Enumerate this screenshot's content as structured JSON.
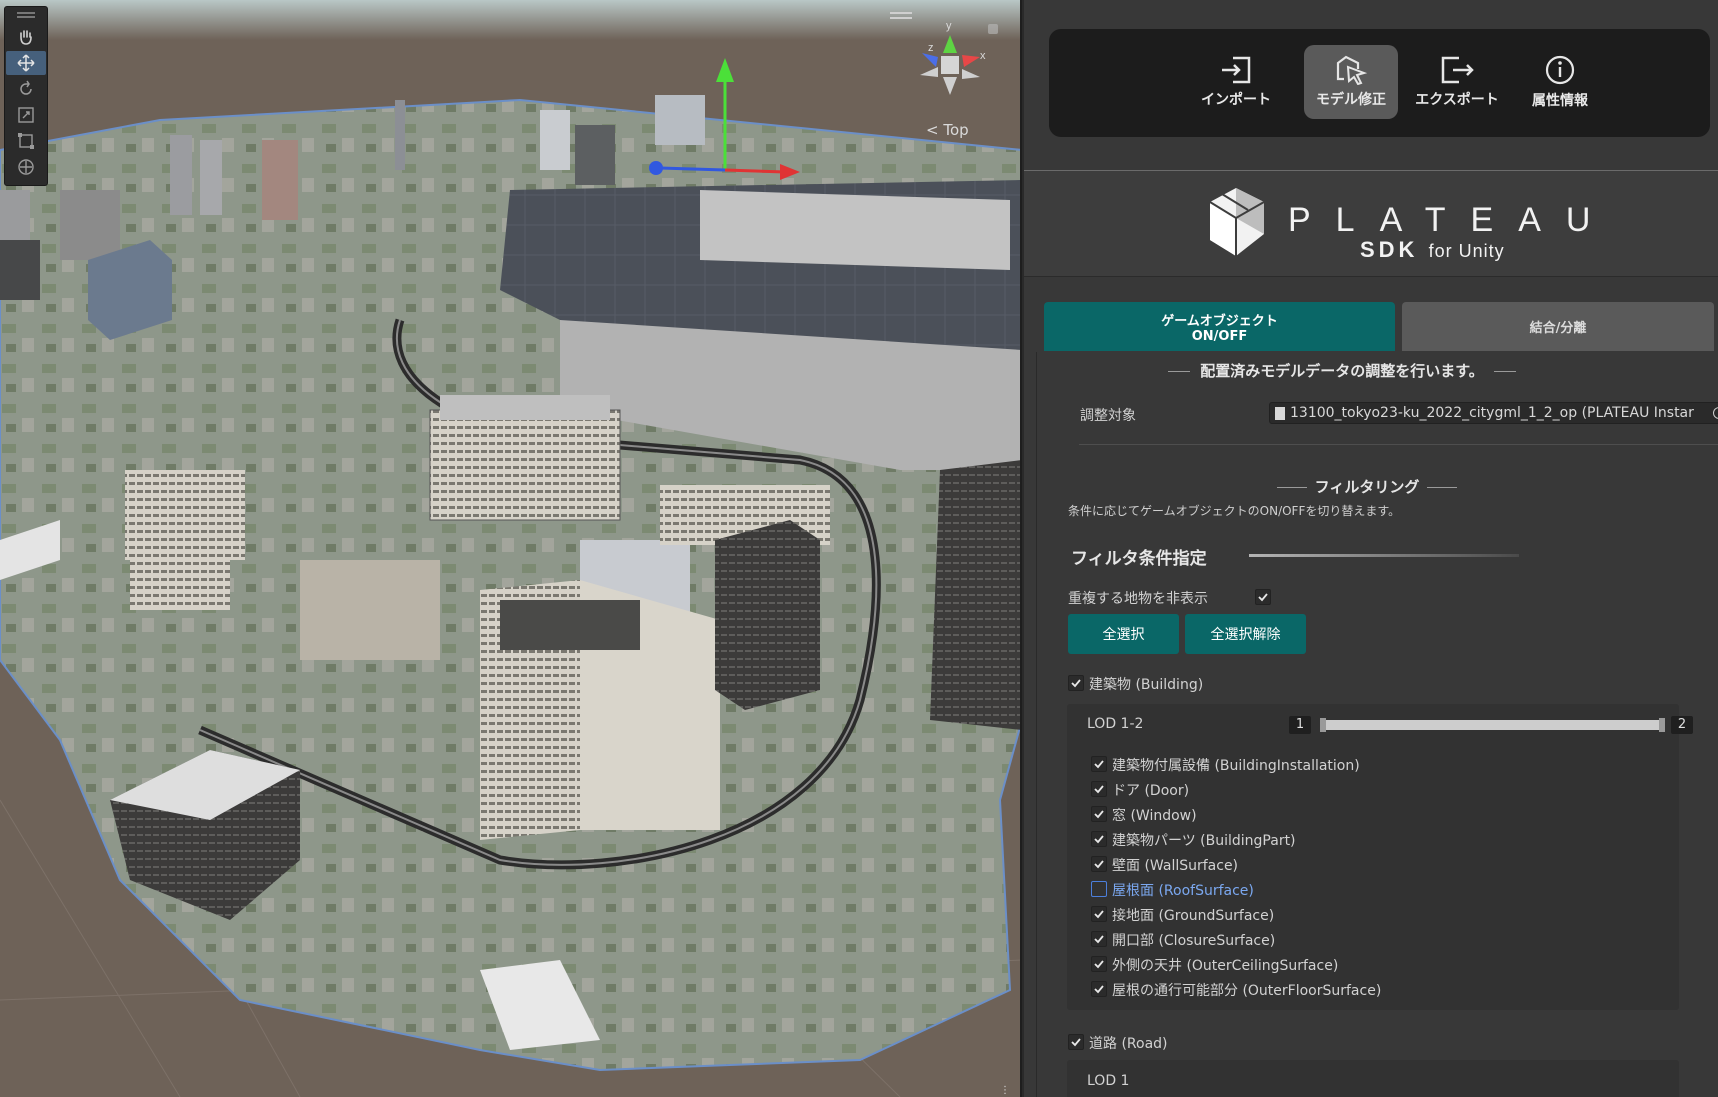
{
  "scene": {
    "gizmo_label": "< Top",
    "gizmo_axes": [
      "y",
      "z",
      "x"
    ],
    "tools": [
      "hand-tool",
      "move-tool",
      "rotate-tool",
      "scale-tool",
      "rect-tool",
      "transform-tool"
    ],
    "active_tool": "move-tool"
  },
  "menu": {
    "import": "インポート",
    "model_edit": "モデル修正",
    "export": "エクスポート",
    "attributes": "属性情報"
  },
  "logo": {
    "title": "PLATEAU",
    "sdk": "SDK",
    "for_unity": "for Unity"
  },
  "tabs": {
    "gameobject_line1": "ゲームオブジェクト",
    "gameobject_line2": "ON/OFF",
    "merge_split": "結合/分離"
  },
  "content": {
    "headline": "配置済みモデルデータの調整を行います。",
    "target_label": "調整対象",
    "target_value": "13100_tokyo23-ku_2022_citygml_1_2_op (PLATEAU Instar",
    "filter_title": "フィルタリング",
    "filter_desc": "条件に応じてゲームオブジェクトのON/OFFを切り替えます。",
    "section_title": "フィルタ条件指定",
    "hide_dup_label": "重複する地物を非表示",
    "select_all": "全選択",
    "deselect_all": "全選択解除",
    "building_label": "建築物 (Building)",
    "lod_label": "LOD 1-2",
    "lod_min": "1",
    "lod_max": "2",
    "items": [
      {
        "label": "建築物付属設備 (BuildingInstallation)",
        "checked": true
      },
      {
        "label": "ドア (Door)",
        "checked": true
      },
      {
        "label": "窓 (Window)",
        "checked": true
      },
      {
        "label": "建築物パーツ (BuildingPart)",
        "checked": true
      },
      {
        "label": "壁面 (WallSurface)",
        "checked": true
      },
      {
        "label": "屋根面 (RoofSurface)",
        "checked": false
      },
      {
        "label": "接地面 (GroundSurface)",
        "checked": true
      },
      {
        "label": "開口部 (ClosureSurface)",
        "checked": true
      },
      {
        "label": "外側の天井 (OuterCeilingSurface)",
        "checked": true
      },
      {
        "label": "屋根の通行可能部分 (OuterFloorSurface)",
        "checked": true
      }
    ],
    "road_label": "道路 (Road)",
    "road_lod_label": "LOD 1"
  },
  "colors": {
    "accent": "#0a6767",
    "highlight": "#7ba8f0"
  }
}
